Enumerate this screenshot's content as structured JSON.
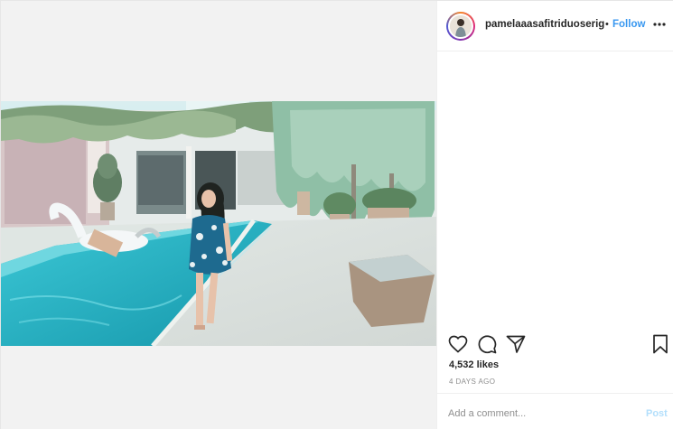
{
  "post": {
    "username": "pamelaaasafitriduoserigal",
    "separator": "•",
    "follow_label": "Follow",
    "likes_count": "4,532",
    "likes_label": "likes",
    "timestamp": "4 DAYS AGO",
    "comment_placeholder": "Add a comment...",
    "post_label": "Post"
  },
  "icons": {
    "more": "more-options-icon",
    "like": "heart-icon",
    "comment": "comment-icon",
    "share": "share-icon",
    "save": "bookmark-icon"
  },
  "colors": {
    "link_blue": "#3897f0",
    "post_disabled": "#b2dffc",
    "muted": "#8e8e8e",
    "text": "#262626",
    "pool": "#27b4c4"
  }
}
